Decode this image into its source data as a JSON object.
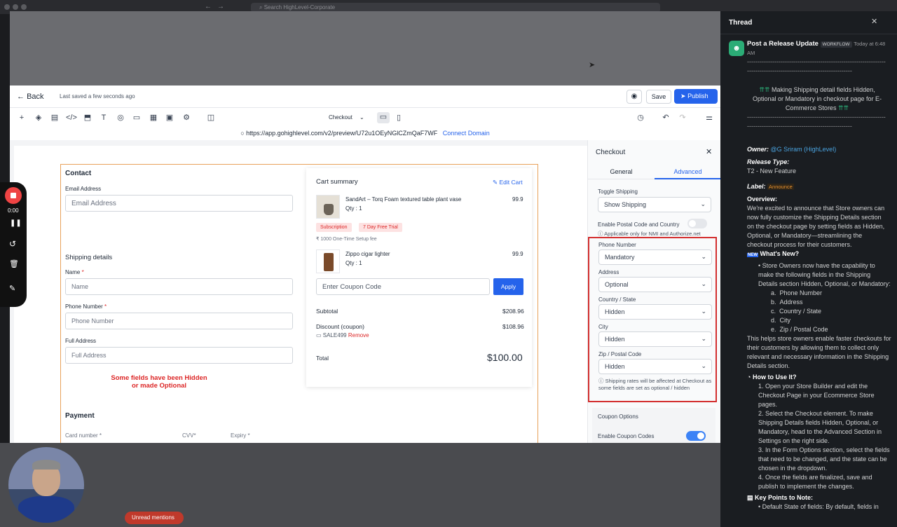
{
  "mac": {
    "search_placeholder": "Search HighLevel-Corporate"
  },
  "builder": {
    "back_label": "Back",
    "saved_status": "Last saved a few seconds ago",
    "save_label": "Save",
    "publish_label": "Publish",
    "element_select": "Checkout",
    "url": "https://app.gohighlevel.com/v2/preview/U72u1OEyNGlCZmQaF7WF",
    "connect_domain": "Connect Domain"
  },
  "checkout": {
    "contact_heading": "Contact",
    "email_label": "Email Address",
    "email_placeholder": "Email Address",
    "shipping_heading": "Shipping details",
    "name_label": "Name",
    "name_placeholder": "Name",
    "phone_label": "Phone Number",
    "phone_placeholder": "Phone Number",
    "address_label": "Full Address",
    "address_placeholder": "Full Address",
    "annotation_line1": "Some fields have been Hidden",
    "annotation_line2": "or made Optional",
    "payment_heading": "Payment",
    "card_label": "Card number",
    "cvv_label": "CVV",
    "expiry_label": "Expiry",
    "required_mark": "*"
  },
  "cart": {
    "heading": "Cart summary",
    "edit_cart": "Edit Cart",
    "items": [
      {
        "name": "SandArt – Torq Foam textured table plant vase",
        "qty": "Qty : 1",
        "price": "99.9"
      },
      {
        "name": "Zippo cigar lighter",
        "qty": "Qty : 1",
        "price": "99.9"
      }
    ],
    "badge_subscription": "Subscription",
    "badge_trial": "7 Day Free Trial",
    "setup_fee": "₹ 1000 One-Time Setup fee",
    "coupon_placeholder": "Enter Coupon Code",
    "apply_label": "Apply",
    "subtotal_label": "Subtotal",
    "subtotal_value": "$208.96",
    "discount_label": "Discount (coupon)",
    "discount_value": "$108.96",
    "coupon_code": "SALE499",
    "remove_label": "Remove",
    "total_label": "Total",
    "total_value": "$100.00"
  },
  "panel": {
    "title": "Checkout",
    "tab_general": "General",
    "tab_advanced": "Advanced",
    "toggle_shipping_label": "Toggle Shipping",
    "toggle_shipping_value": "Show Shipping",
    "postal_toggle_label": "Enable Postal Code and Country",
    "postal_note": "Applicable only for NMI and Authorize.net",
    "fields": [
      {
        "label": "Phone Number",
        "value": "Mandatory"
      },
      {
        "label": "Address",
        "value": "Optional"
      },
      {
        "label": "Country / State",
        "value": "Hidden"
      },
      {
        "label": "City",
        "value": "Hidden"
      },
      {
        "label": "Zip / Postal Code",
        "value": "Hidden"
      }
    ],
    "fields_note": "Shipping rates will be affected at Checkout as some fields are set as optional / hidden",
    "coupon_options": "Coupon Options",
    "enable_coupon": "Enable Coupon Codes"
  },
  "recorder": {
    "time": "0:00"
  },
  "thread": {
    "title": "Thread",
    "workflow_name": "Post a Release Update",
    "workflow_badge": "WORKFLOW",
    "time_line1": "Today at 6:48",
    "time_line2": "AM",
    "dashes1": "--------------------------------------------------------------------------------------------------------------------",
    "headline": "Making Shipping detail fields Hidden, Optional or Mandatory in checkout page for E-Commerce Stores",
    "owner_label": "Owner:",
    "owner_value": "@G Sriram (HighLevel)",
    "release_type_label": "Release Type:",
    "release_type_value": "T2 - New Feature",
    "label_label": "Label:",
    "label_value": "Announce",
    "overview_label": "Overview:",
    "overview_text": "We're excited to announce that Store owners can now fully customize the Shipping Details section on the checkout page by setting fields as Hidden, Optional, or Mandatory—streamlining the checkout process for their customers.",
    "whats_new": "What's New?",
    "new_text": "Store Owners now have the capability to make the following fields in the Shipping Details section Hidden, Optional, or Mandatory:",
    "subitems": [
      "Phone Number",
      "Address",
      "Country / State",
      "City",
      "Zip / Postal Code"
    ],
    "helps_text": "This helps store owners enable faster checkouts for their customers by allowing them to collect only relevant and necessary information in the Shipping Details section.",
    "how_to": "How to Use It?",
    "steps": [
      "Open your Store Builder and edit the Checkout Page in your Ecommerce Store pages.",
      "Select the Checkout element. To make Shipping Details fields Hidden, Optional, or Mandatory, head to the Advanced Section in Settings on the right side.",
      "In the Form Options section, select the fields that need to be changed, and the state can be chosen in the dropdown.",
      "Once the fields are finalized, save and publish to implement the changes."
    ],
    "key_points": "Key Points to Note:",
    "key_first": "Default State of fields: By default, fields in"
  },
  "bottom": {
    "unread": "Unread mentions"
  }
}
